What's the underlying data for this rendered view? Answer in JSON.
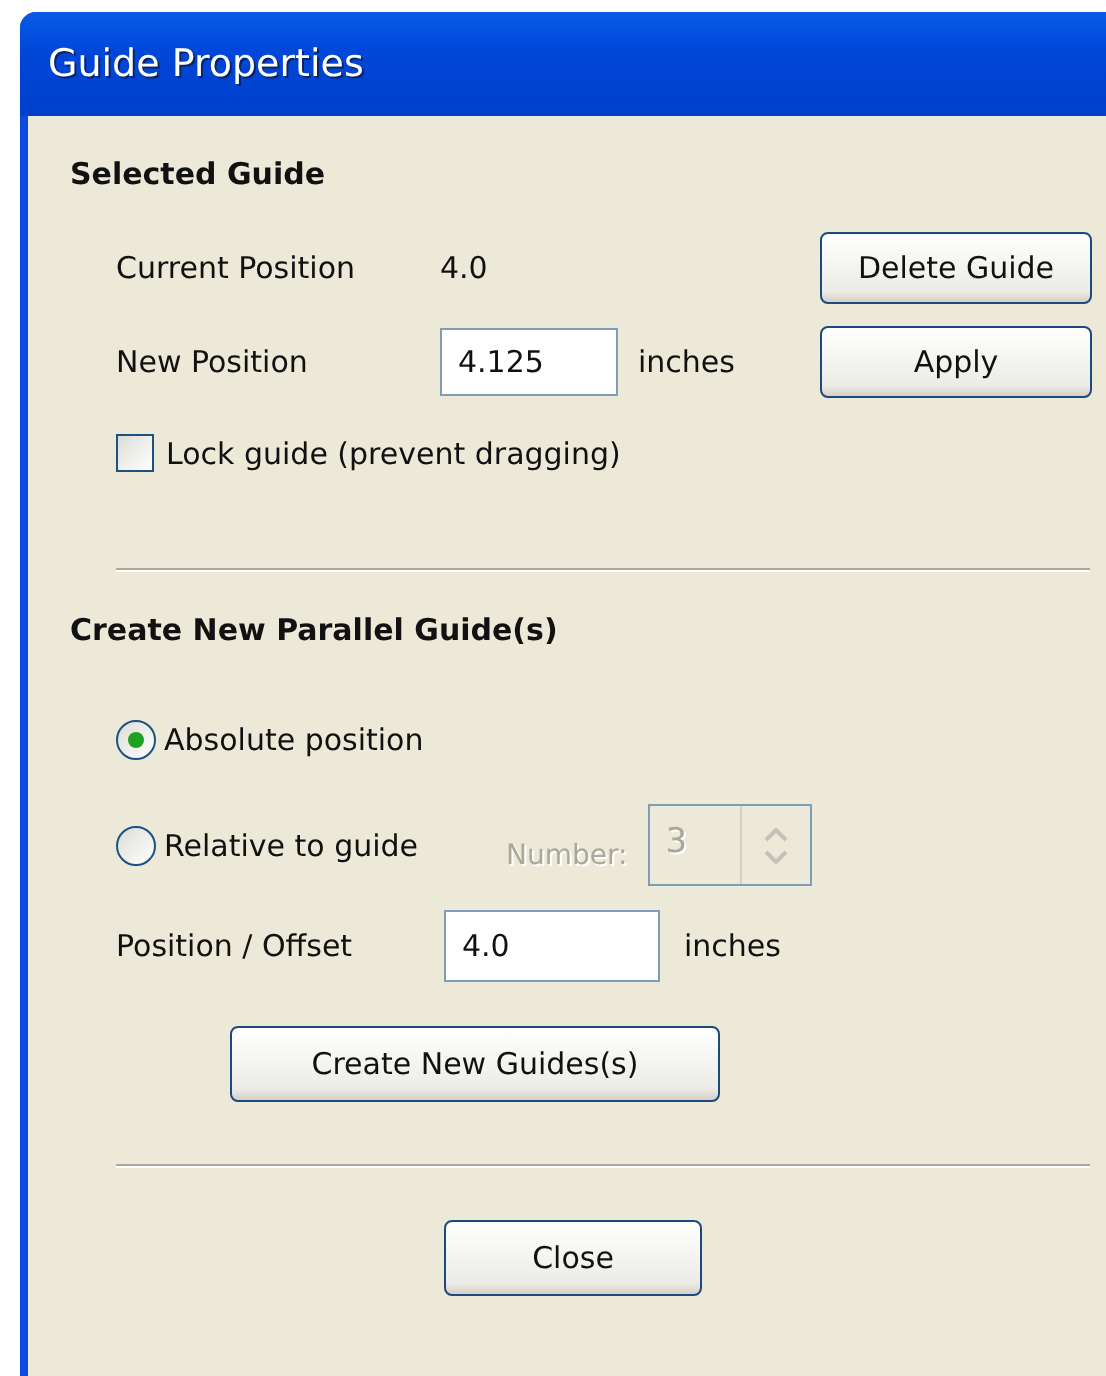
{
  "window": {
    "title": "Guide Properties"
  },
  "selected_guide": {
    "heading": "Selected Guide",
    "current_position": {
      "label": "Current Position",
      "value": "4.0"
    },
    "delete_button": "Delete Guide",
    "new_position": {
      "label": "New Position",
      "value": "4.125",
      "unit": "inches"
    },
    "apply_button": "Apply",
    "lock": {
      "label": "Lock guide (prevent dragging)",
      "checked": false
    }
  },
  "parallel": {
    "heading": "Create New Parallel Guide(s)",
    "options": [
      {
        "label": "Absolute position",
        "selected": true
      },
      {
        "label": "Relative to guide",
        "selected": false
      }
    ],
    "number": {
      "label": "Number:",
      "value": "3",
      "disabled": true
    },
    "offset": {
      "label": "Position / Offset",
      "value": "4.0",
      "unit": "inches"
    },
    "create_button": "Create New Guides(s)"
  },
  "close_button": "Close"
}
